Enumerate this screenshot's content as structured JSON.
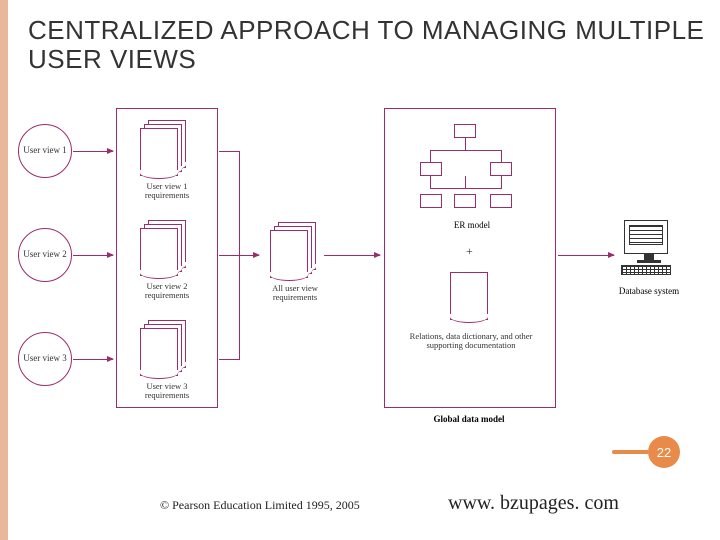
{
  "title": "CENTRALIZED APPROACH TO MANAGING MULTIPLE USER VIEWS",
  "user_views": [
    "User view 1",
    "User view 2",
    "User view 3"
  ],
  "requirements": {
    "items": [
      "User view 1 requirements",
      "User view 2 requirements",
      "User view 3 requirements"
    ],
    "merged": "All user view requirements"
  },
  "model_box": {
    "er_label": "ER model",
    "plus": "+",
    "supporting": "Relations, data dictionary, and other supporting documentation",
    "caption": "Global data model"
  },
  "output": {
    "label": "Database system"
  },
  "page_number": "22",
  "copyright": "© Pearson Education Limited 1995, 2005",
  "url": "www. bzupages. com"
}
